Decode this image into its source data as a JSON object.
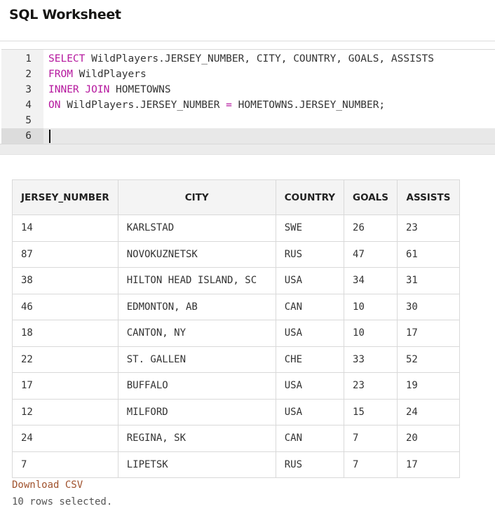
{
  "page": {
    "title": "SQL Worksheet"
  },
  "editor": {
    "line_numbers": [
      "1",
      "2",
      "3",
      "4",
      "5",
      "6"
    ],
    "lines": [
      {
        "kw": "SELECT",
        "rest": " WildPlayers.JERSEY_NUMBER, CITY, COUNTRY, GOALS, ASSISTS"
      },
      {
        "kw": "FROM",
        "rest": " WildPlayers"
      },
      {
        "kw": "INNER JOIN",
        "rest": " HOMETOWNS"
      },
      {
        "kw": "ON",
        "rest_a": " WildPlayers.JERSEY_NUMBER ",
        "op": "=",
        "rest_b": " HOMETOWNS.JERSEY_NUMBER;"
      },
      {
        "kw": "",
        "rest": ""
      },
      {
        "kw": "",
        "rest": ""
      }
    ],
    "active_line": 6
  },
  "results": {
    "columns": [
      "JERSEY_NUMBER",
      "CITY",
      "COUNTRY",
      "GOALS",
      "ASSISTS"
    ],
    "rows": [
      [
        "14",
        "KARLSTAD",
        "SWE",
        "26",
        "23"
      ],
      [
        "87",
        "NOVOKUZNETSK",
        "RUS",
        "47",
        "61"
      ],
      [
        "38",
        "HILTON HEAD ISLAND, SC",
        "USA",
        "34",
        "31"
      ],
      [
        "46",
        "EDMONTON, AB",
        "CAN",
        "10",
        "30"
      ],
      [
        "18",
        "CANTON, NY",
        "USA",
        "10",
        "17"
      ],
      [
        "22",
        "ST. GALLEN",
        "CHE",
        "33",
        "52"
      ],
      [
        "17",
        "BUFFALO",
        "USA",
        "23",
        "19"
      ],
      [
        "12",
        "MILFORD",
        "USA",
        "15",
        "24"
      ],
      [
        "24",
        "REGINA, SK",
        "CAN",
        "7",
        "20"
      ],
      [
        "7",
        "LIPETSK",
        "RUS",
        "7",
        "17"
      ]
    ],
    "download_label": "Download CSV",
    "rows_selected": "10 rows selected."
  },
  "colors": {
    "keyword": "#b5179e",
    "link": "#a0522d"
  }
}
